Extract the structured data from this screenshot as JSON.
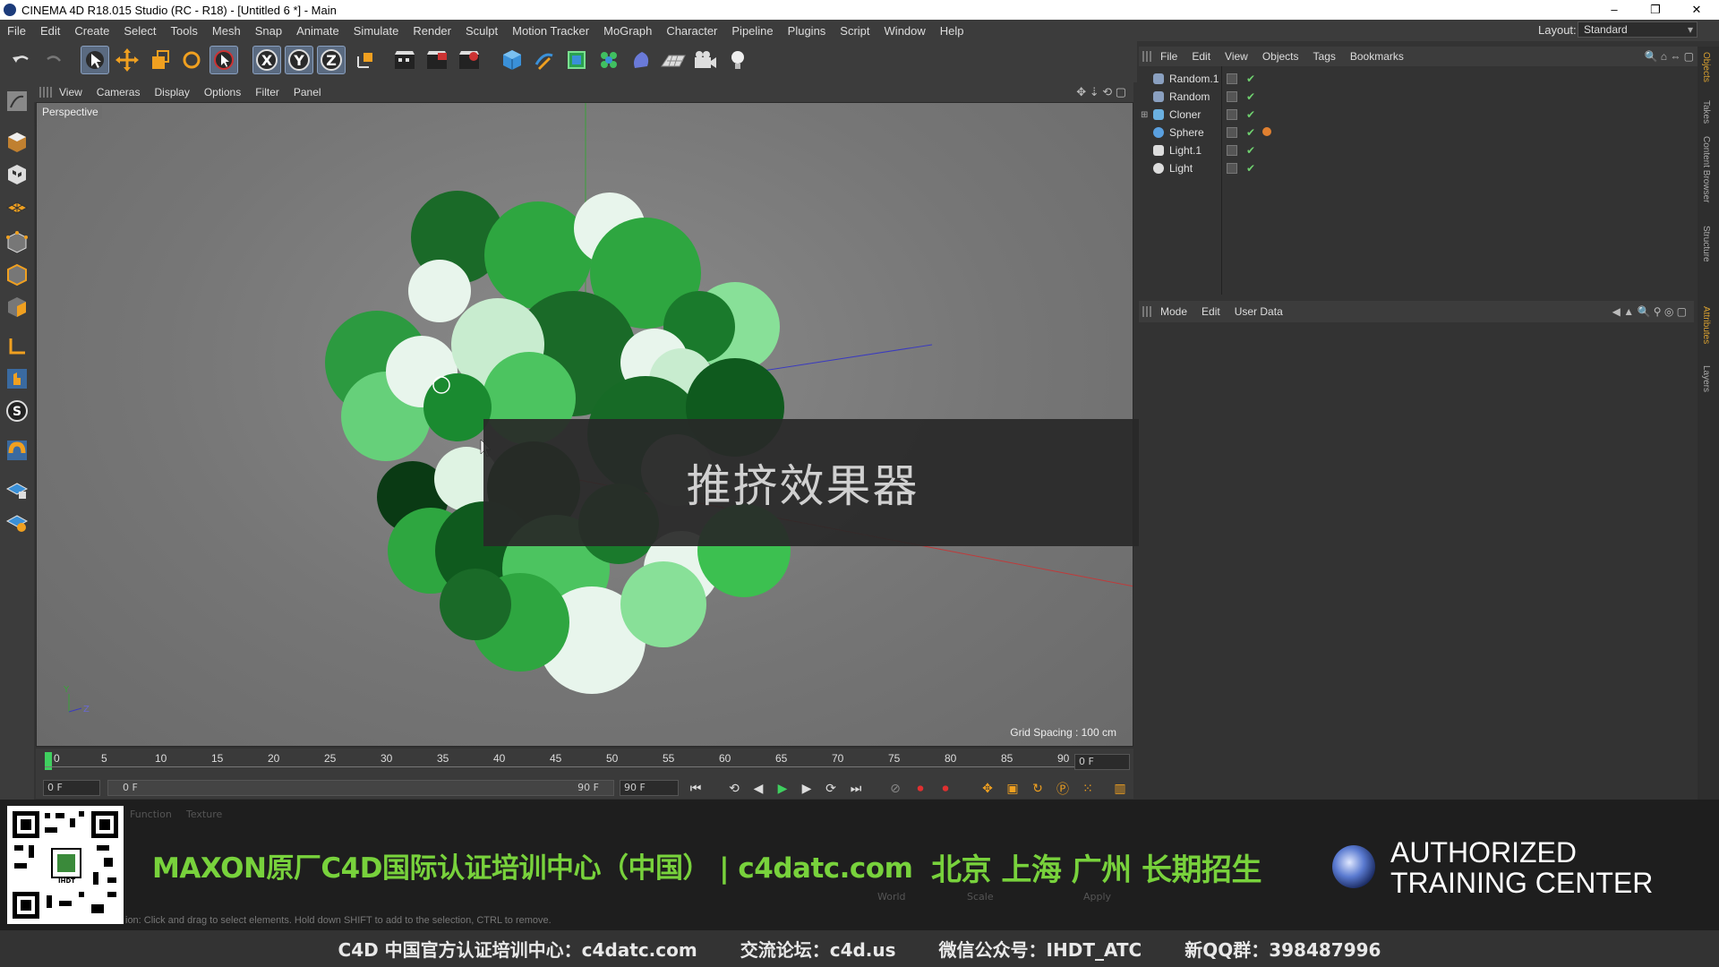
{
  "window": {
    "title": "CINEMA 4D R18.015 Studio (RC - R18) - [Untitled 6 *] - Main",
    "minimize": "–",
    "restore": "❐",
    "close": "✕"
  },
  "menubar": {
    "items": [
      "File",
      "Edit",
      "Create",
      "Select",
      "Tools",
      "Mesh",
      "Snap",
      "Animate",
      "Simulate",
      "Render",
      "Sculpt",
      "Motion Tracker",
      "MoGraph",
      "Character",
      "Pipeline",
      "Plugins",
      "Script",
      "Window",
      "Help"
    ],
    "layout_label": "Layout:",
    "layout_value": "Standard"
  },
  "toolbar": {
    "icons": [
      "undo-icon",
      "redo-icon",
      "live-selection-icon",
      "move-icon",
      "scale-icon",
      "rotate-icon",
      "recent-tool-icon",
      "x-axis-icon",
      "y-axis-icon",
      "z-axis-icon",
      "coordinate-system-icon",
      "render-view-icon",
      "render-picture-viewer-icon",
      "render-settings-icon",
      "cube-icon",
      "pen-icon",
      "subdivision-icon",
      "cloner-icon",
      "deformer-icon",
      "floor-icon",
      "camera-icon",
      "light-icon"
    ],
    "axis_x": "X",
    "axis_y": "Y",
    "axis_z": "Z"
  },
  "left_tools": [
    "make-editable-icon",
    "model-mode-icon",
    "texture-mode-icon",
    "workplane-icon",
    "points-mode-icon",
    "edges-mode-icon",
    "polygons-mode-icon",
    "axis-mode-icon",
    "tweak-icon",
    "snap-icon",
    "magnet-icon",
    "lock-workplane-icon",
    "planar-workplane-icon"
  ],
  "viewport": {
    "menu": [
      "View",
      "Cameras",
      "Display",
      "Options",
      "Filter",
      "Panel"
    ],
    "camera_label": "Perspective",
    "grid_spacing": "Grid Spacing : 100 cm",
    "axis_y": "Y",
    "axis_z": "Z"
  },
  "caption": "推挤效果器",
  "timeline": {
    "ticks": [
      "0",
      "5",
      "10",
      "15",
      "20",
      "25",
      "30",
      "35",
      "40",
      "45",
      "50",
      "55",
      "60",
      "65",
      "70",
      "75",
      "80",
      "85",
      "90"
    ],
    "current_frame": "0 F",
    "start_field": "0 F",
    "range_start": "0 F",
    "range_end": "90 F",
    "end_field": "90 F"
  },
  "object_manager": {
    "menu": [
      "File",
      "Edit",
      "View",
      "Objects",
      "Tags",
      "Bookmarks"
    ],
    "objects": [
      {
        "name": "Random.1",
        "color": "#8aa0c0"
      },
      {
        "name": "Random",
        "color": "#8aa0c0"
      },
      {
        "name": "Cloner",
        "color": "#6ab0e0"
      },
      {
        "name": "Sphere",
        "color": "#5aa0e0"
      },
      {
        "name": "Light.1",
        "color": "#dddddd"
      },
      {
        "name": "Light",
        "color": "#dddddd"
      }
    ],
    "checkmark": "✔"
  },
  "attribute_manager": {
    "menu": [
      "Mode",
      "Edit",
      "User Data"
    ]
  },
  "side_tabs": [
    "Objects",
    "Takes",
    "Content Browser",
    "Structure",
    "Attributes",
    "Layers"
  ],
  "banner": {
    "title": "MAXON原厂C4D国际认证培训中心（中国） |  c4datc.com",
    "cities": "北京 上海 广州 长期招生",
    "atc": "AUTHORIZED TRAINING CENTER",
    "qr_label": "IHDT"
  },
  "status_hint": "ion: Click and drag to select elements. Hold down SHIFT to add to the selection, CTRL to remove.",
  "coord_panel": {
    "tabs": [
      "Function",
      "Texture"
    ],
    "world": "World",
    "scale": "Scale",
    "apply": "Apply"
  },
  "footer": {
    "site": "C4D 中国官方认证培训中心：c4datc.com",
    "forum": "交流论坛：c4d.us",
    "wechat": "微信公众号：IHDT_ATC",
    "qq": "新QQ群：398487996"
  },
  "colors": {
    "accent_green": "#78d23c",
    "ui_dark": "#3c3c3c",
    "viewport_bg": "#7a7a7a"
  }
}
